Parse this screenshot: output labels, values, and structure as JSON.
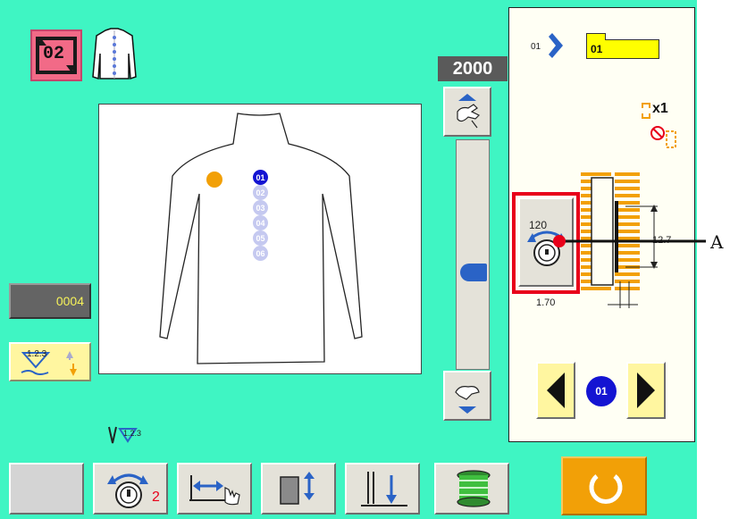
{
  "header": {
    "program_number": "02"
  },
  "speed": {
    "value": "2000"
  },
  "side_buttons": {
    "stitch_count": "0004",
    "thread_tension_label": "1.2.3"
  },
  "indicator": {
    "needle_label": "1.2.3"
  },
  "canvas": {
    "buttons": [
      "01",
      "02",
      "03",
      "04",
      "05",
      "06"
    ]
  },
  "right_panel": {
    "pattern_label": "01",
    "pattern_value": "01",
    "repeat_label": "x1",
    "thread_angle": "120",
    "dim_height": "12.7",
    "dim_width": "1.70",
    "current_button": "01"
  },
  "callout": {
    "label": "A"
  },
  "bottom": {
    "thread_trim_count": "2"
  },
  "colors": {
    "screen": "#3ff5c3",
    "canvas": "#ffffff",
    "accent_orange": "#f2a007",
    "button_blue": "#1414d2",
    "button_faded": "#c5c9f0",
    "highlight_red": "#e8001a",
    "yellow": "#fff98a"
  }
}
